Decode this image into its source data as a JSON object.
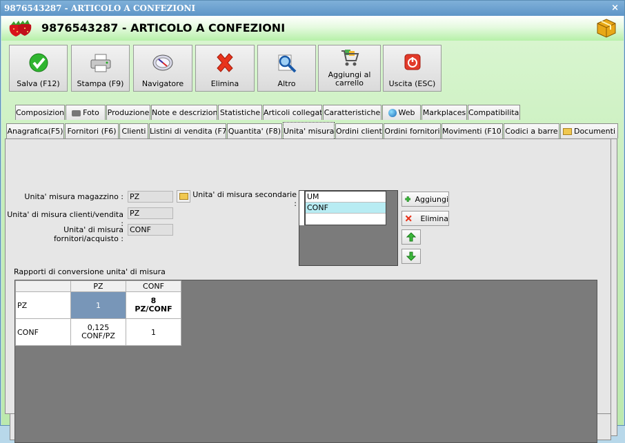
{
  "window": {
    "title": "9876543287 - ARTICOLO A CONFEZIONI",
    "close_symbol": "×"
  },
  "header": {
    "title": "9876543287 - ARTICOLO A CONFEZIONI",
    "left_icon": "strawberry-icon",
    "right_icon": "cube-icon"
  },
  "toolbar": {
    "buttons": [
      {
        "label": "Salva (F12)",
        "icon": "check-icon"
      },
      {
        "label": "Stampa (F9)",
        "icon": "printer-icon"
      },
      {
        "label": "Navigatore",
        "icon": "compass-icon"
      },
      {
        "label": "Elimina",
        "icon": "delete-icon"
      },
      {
        "label": "Altro",
        "icon": "magnifier-icon"
      },
      {
        "label": "Aggiungi al carrello",
        "icon": "cart-icon"
      },
      {
        "label": "Uscita (ESC)",
        "icon": "power-icon"
      }
    ]
  },
  "tabs_row1": [
    "Composizioni",
    "Foto",
    "Produzione",
    "Note e descrizioni",
    "Statistiche",
    "Articoli collegati",
    "Caratteristiche",
    "Web",
    "Markplaces",
    "Compatibilita'"
  ],
  "tabs_row2": [
    "Anagrafica(F5)",
    "Fornitori (F6)",
    "Clienti",
    "Listini di vendita (F7)",
    "Quantita' (F8)",
    "Unita' misura",
    "Ordini clienti",
    "Ordini fornitori",
    "Movimenti (F10)",
    "Codici a barre",
    "Documenti"
  ],
  "active_tab": "Unita' misura",
  "unita": {
    "magazzino_label": "Unita' misura magazzino :",
    "magazzino_value": "PZ",
    "clienti_label": "Unita' di misura clienti/vendita :",
    "clienti_value": "PZ",
    "fornitori_label": "Unita' di misura fornitori/acquisto :",
    "fornitori_value": "CONF",
    "secondarie_label": "Unita' di misura secondarie :",
    "secondarie_header": "UM",
    "secondarie_rows": [
      "CONF",
      ""
    ],
    "aggiungi_label": "Aggiungi",
    "elimina_label": "Elimina"
  },
  "conversione": {
    "title": "Rapporti di conversione unita' di misura",
    "columns": [
      "",
      "PZ",
      "CONF"
    ],
    "rows": [
      {
        "um": "PZ",
        "pz": "1",
        "conf_line1": "8",
        "conf_line2": "PZ/CONF"
      },
      {
        "um": "CONF",
        "pz_line1": "0,125",
        "pz_line2": "CONF/PZ",
        "conf": "1"
      }
    ]
  },
  "colors": {
    "titlebar": "#6aa0cf",
    "header_green": "#b6f0a8",
    "content_green": "#c7eebb",
    "selected_cell": "#7896b8",
    "selected_row": "#b8ecf3"
  }
}
